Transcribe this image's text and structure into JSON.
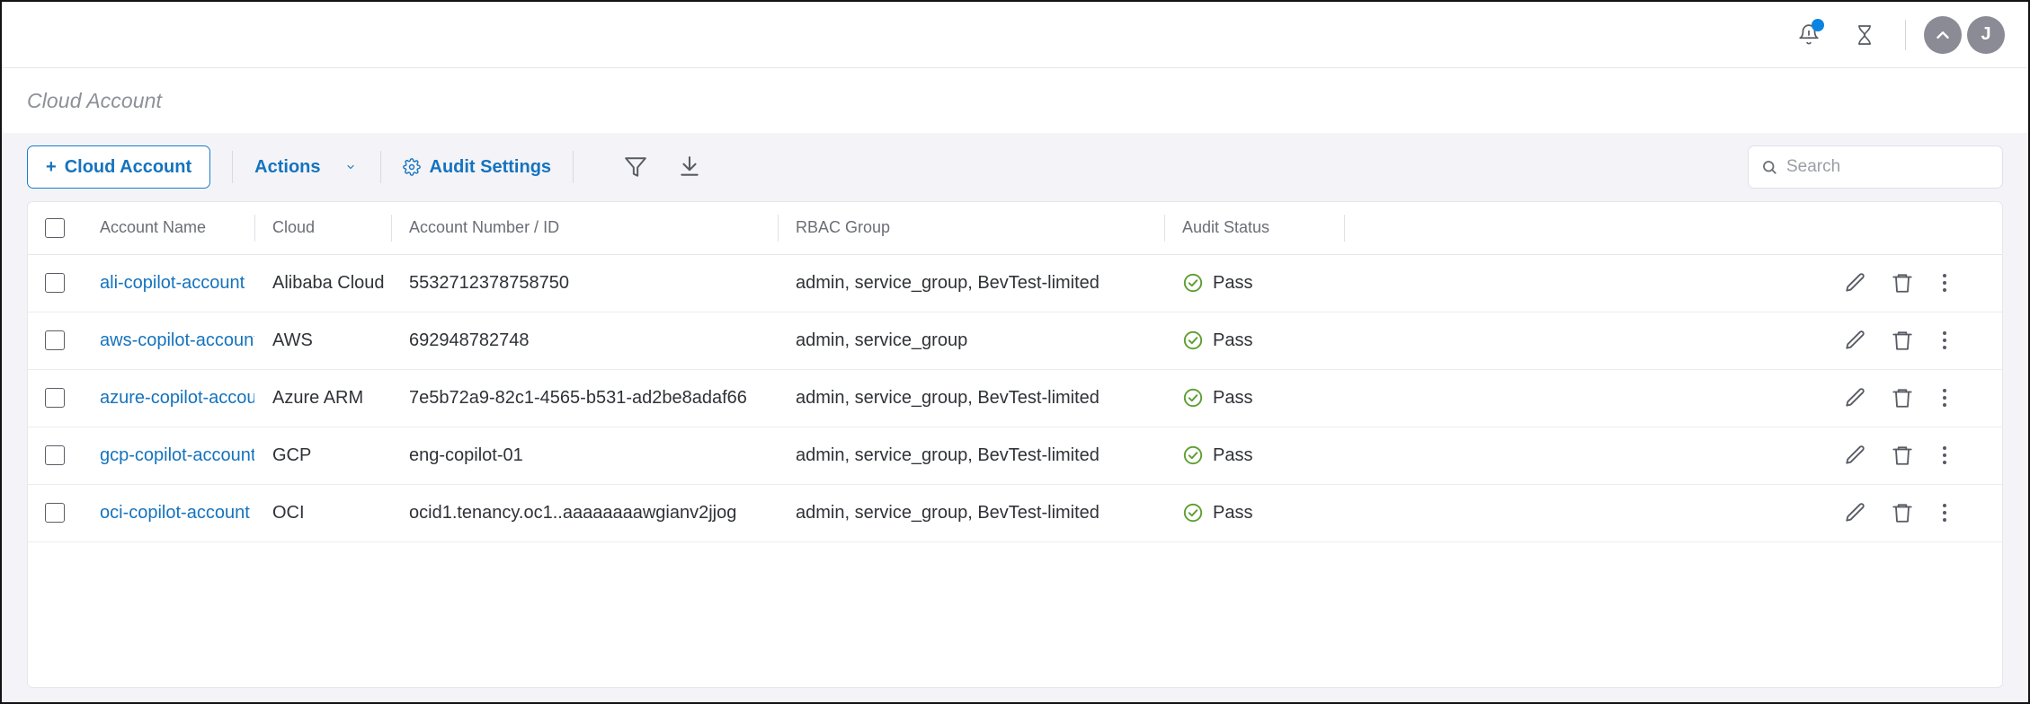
{
  "header": {
    "icons": [
      {
        "name": "notifications-icon",
        "label": "Notifications",
        "has_badge": true
      },
      {
        "name": "hourglass-icon",
        "label": "Pending Tasks"
      }
    ],
    "up_caret_label": "",
    "avatar_initial": "J",
    "badge_color": "#0a84e0",
    "avatar_color": "#8a8b95"
  },
  "breadcrumb": {
    "text": "Cloud Account"
  },
  "toolbar": {
    "add_button_label": "Cloud Account",
    "add_button_plus": "+",
    "actions_label": "Actions",
    "audit_settings_label": "Audit Settings",
    "filter_icon": "filter-icon",
    "download_icon": "download-icon",
    "accent_color": "#1573be"
  },
  "search": {
    "placeholder": "Search",
    "value": ""
  },
  "table": {
    "columns": [
      {
        "key": "select",
        "label": ""
      },
      {
        "key": "account_name",
        "label": "Account Name"
      },
      {
        "key": "cloud",
        "label": "Cloud"
      },
      {
        "key": "account_number",
        "label": "Account Number / ID"
      },
      {
        "key": "rbac_group",
        "label": "RBAC Group"
      },
      {
        "key": "audit_status",
        "label": "Audit Status"
      },
      {
        "key": "actions",
        "label": ""
      }
    ],
    "rows": [
      {
        "account_name": "ali-copilot-account",
        "cloud": "Alibaba Cloud",
        "account_number": "5532712378758750",
        "rbac_group": "admin, service_group, BevTest-limited",
        "audit_status": "Pass",
        "selected": false
      },
      {
        "account_name": "aws-copilot-account",
        "cloud": "AWS",
        "account_number": "692948782748",
        "rbac_group": "admin, service_group",
        "audit_status": "Pass",
        "selected": false
      },
      {
        "account_name": "azure-copilot-account",
        "cloud": "Azure ARM",
        "account_number": "7e5b72a9-82c1-4565-b531-ad2be8adaf66",
        "rbac_group": "admin, service_group, BevTest-limited",
        "audit_status": "Pass",
        "selected": false
      },
      {
        "account_name": "gcp-copilot-account",
        "cloud": "GCP",
        "account_number": "eng-copilot-01",
        "rbac_group": "admin, service_group, BevTest-limited",
        "audit_status": "Pass",
        "selected": false
      },
      {
        "account_name": "oci-copilot-account",
        "cloud": "OCI",
        "account_number": "ocid1.tenancy.oc1..aaaaaaaawgianv2jjog",
        "rbac_group": "admin, service_group, BevTest-limited",
        "audit_status": "Pass",
        "selected": false
      }
    ],
    "row_action_icons": [
      "edit-pencil-icon",
      "trash-icon",
      "more-vertical-icon"
    ],
    "status_pass_color": "#5d9e31"
  }
}
